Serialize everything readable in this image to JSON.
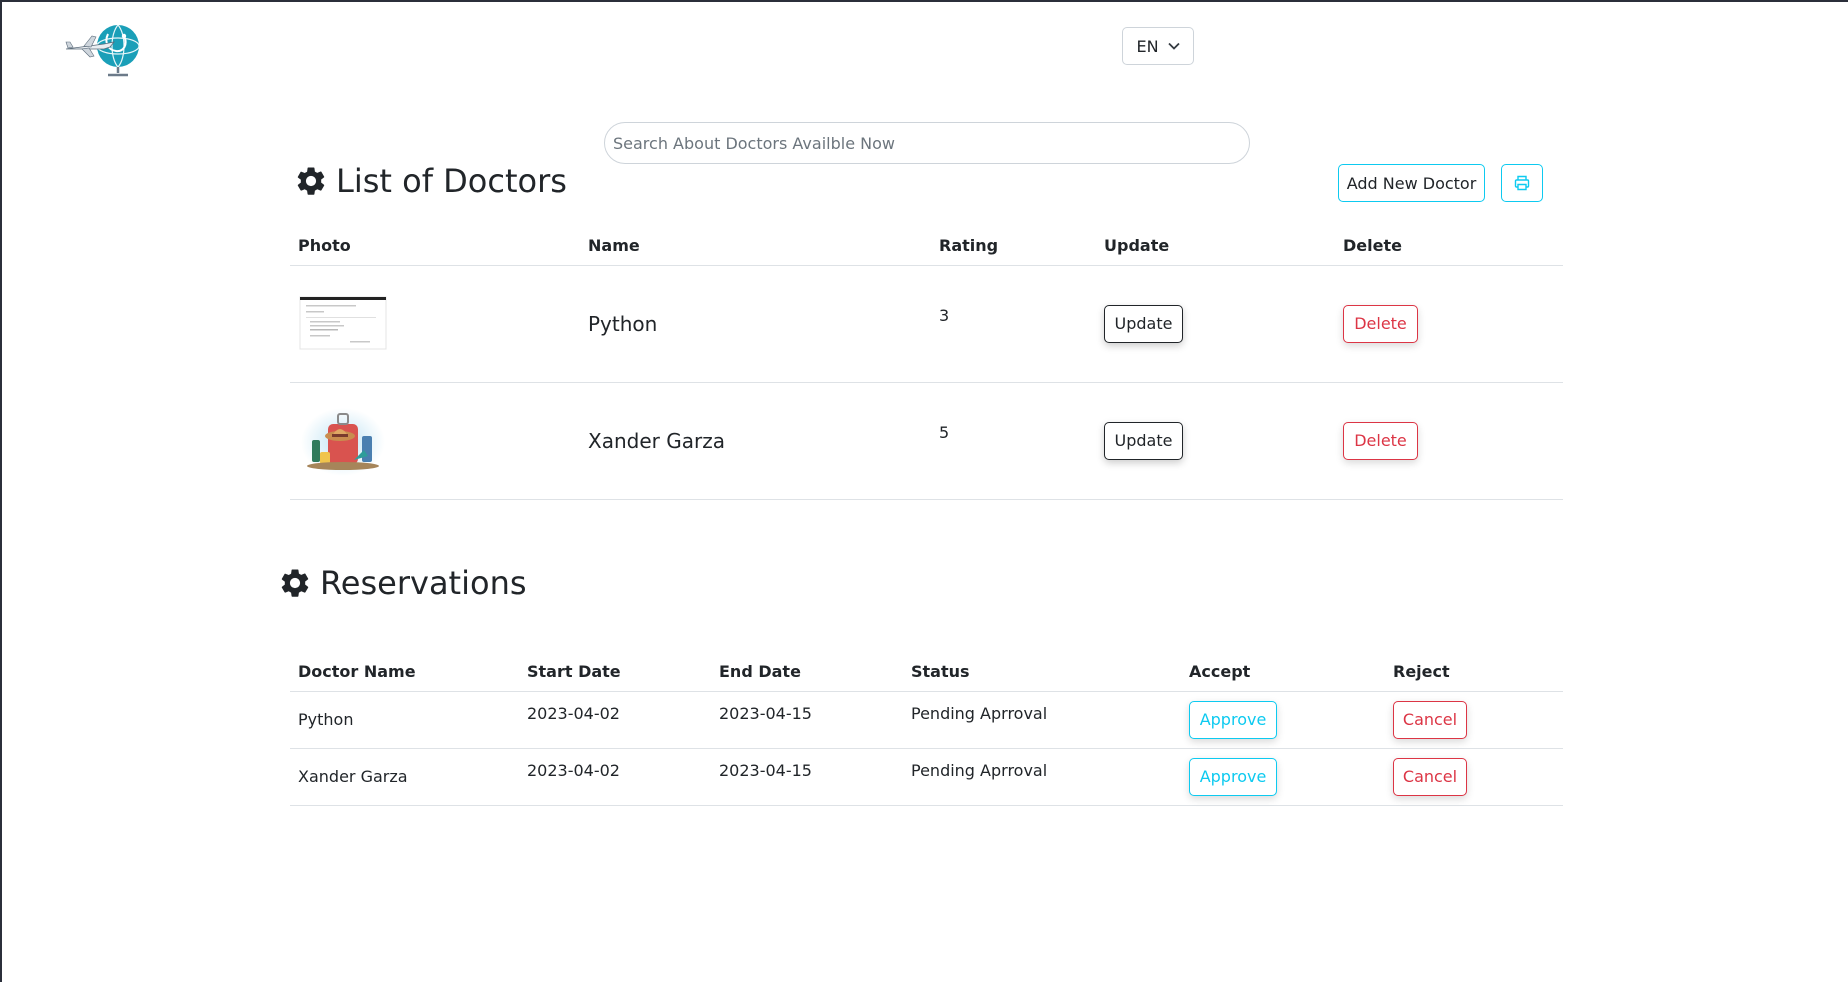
{
  "header": {
    "language": "EN"
  },
  "search": {
    "placeholder": "Search About Doctors Availble Now"
  },
  "doctors_section": {
    "title": "List of Doctors",
    "add_button": "Add New Doctor",
    "print_icon": "printer-icon",
    "columns": [
      "Photo",
      "Name",
      "Rating",
      "Update",
      "Delete"
    ],
    "rows": [
      {
        "name": "Python",
        "rating": "3",
        "update": "Update",
        "delete": "Delete",
        "photo": "screenshot-thumbnail"
      },
      {
        "name": "Xander Garza",
        "rating": "5",
        "update": "Update",
        "delete": "Delete",
        "photo": "luggage-travel-illustration"
      }
    ]
  },
  "reservations_section": {
    "title": "Reservations",
    "columns": [
      "Doctor Name",
      "Start Date",
      "End Date",
      "Status",
      "Accept",
      "Reject"
    ],
    "rows": [
      {
        "doctor": "Python",
        "start": "2023-04-02",
        "end": "2023-04-15",
        "status": "Pending Aprroval",
        "accept": "Approve",
        "reject": "Cancel"
      },
      {
        "doctor": "Xander Garza",
        "start": "2023-04-02",
        "end": "2023-04-15",
        "status": "Pending Aprroval",
        "accept": "Approve",
        "reject": "Cancel"
      }
    ]
  },
  "colors": {
    "info": "#0dcaf0",
    "danger": "#dc3545",
    "dark": "#212529",
    "border": "#dee2e6"
  }
}
